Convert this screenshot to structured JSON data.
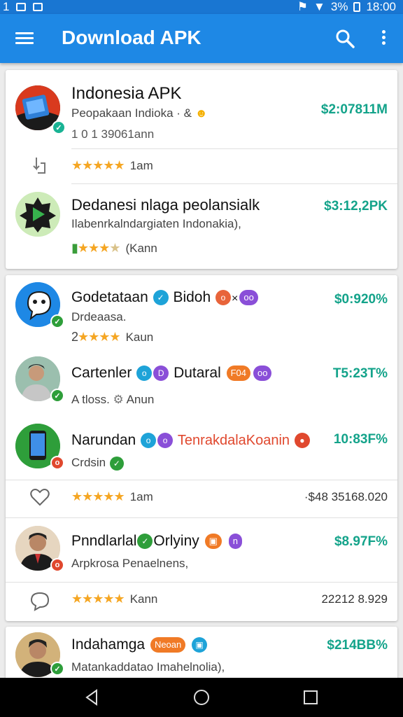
{
  "status": {
    "battery": "3%",
    "time": "18:00"
  },
  "appbar": {
    "title": "Download APK"
  },
  "card1": {
    "app1": {
      "name": "Indonesia APK",
      "desc": "Peopakaan Indioka · &",
      "meta": "1 0 1 39061ann",
      "price": "$2:07811M",
      "rating_text": "1am"
    },
    "app2": {
      "name": "Dedanesi nlaga peolansialk",
      "desc": "Ilabenrkalndargiaten Indonakia),",
      "price": "$3:12,2PK",
      "rating_text": "(Kann"
    }
  },
  "card2": {
    "app1": {
      "name": "Godetataan",
      "tag": "Bidoh",
      "desc": "Drdeaasa.",
      "meta_prefix": "2",
      "rating_text": "Kaun",
      "price": "$0:920%"
    },
    "app2": {
      "name": "Cartenler",
      "tag": "Dutaral",
      "pill": "F04",
      "meta": "A tloss.",
      "rating_text": "Anun",
      "price": "T5:23T%"
    },
    "app3": {
      "name": "Narundan",
      "tag": "TenrakdalaKoanin",
      "desc": "Crdsin",
      "price": "10:83F%"
    },
    "footer1": {
      "rating_text": "1am",
      "amount": "·$48 35168.020"
    },
    "app4": {
      "name": "Pnndlarlal",
      "tag": "Orlyiny",
      "desc": "Arpkrosa Penaelnens,",
      "price": "$8.97F%"
    },
    "footer2": {
      "rating_text": "Kann",
      "amount": "22212 8.929"
    }
  },
  "card3": {
    "app1": {
      "name": "Indahamga",
      "pill": "Neoan",
      "desc": "Matankaddatao Imahelnolia),",
      "price": "$214BB%"
    }
  },
  "colors": {
    "appbar": "#1e88e5",
    "price": "#13a38a",
    "star": "#f5a623"
  }
}
